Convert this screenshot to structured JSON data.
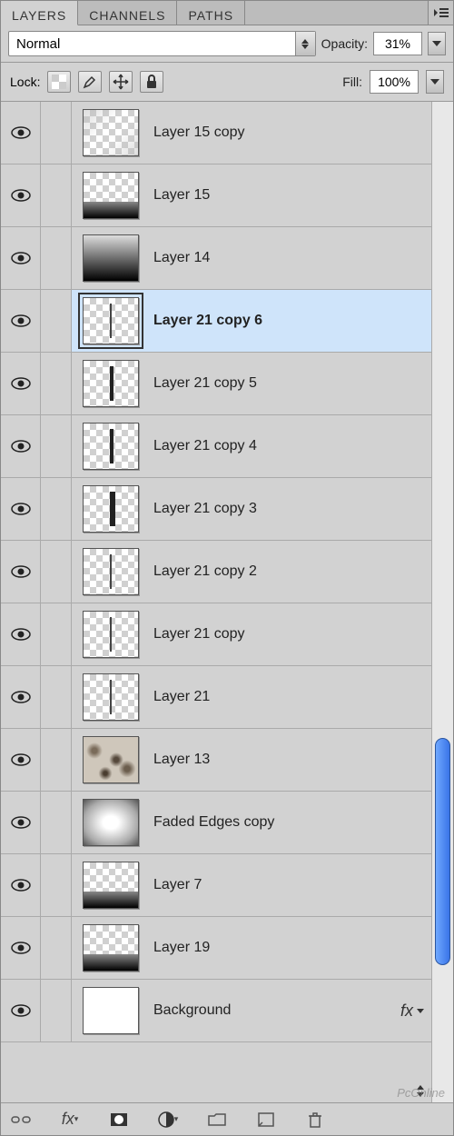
{
  "tabs": {
    "layers": "LAYERS",
    "channels": "CHANNELS",
    "paths": "PATHS"
  },
  "controls": {
    "blend_mode": "Normal",
    "opacity_label": "Opacity:",
    "opacity_value": "31%",
    "fill_label": "Fill:",
    "fill_value": "100%",
    "lock_label": "Lock:"
  },
  "layers": [
    {
      "name": "Layer 15 copy",
      "selected": false,
      "thumb": "checker-shade"
    },
    {
      "name": "Layer 15",
      "selected": false,
      "thumb": "checker-darkband"
    },
    {
      "name": "Layer 14",
      "selected": false,
      "thumb": "grad"
    },
    {
      "name": "Layer 21 copy 6",
      "selected": true,
      "thumb": "checker-vline-thin"
    },
    {
      "name": "Layer 21 copy 5",
      "selected": false,
      "thumb": "checker-vline-med"
    },
    {
      "name": "Layer 21 copy 4",
      "selected": false,
      "thumb": "checker-vline-med"
    },
    {
      "name": "Layer 21 copy 3",
      "selected": false,
      "thumb": "checker-vline-thick"
    },
    {
      "name": "Layer 21 copy 2",
      "selected": false,
      "thumb": "checker-vline-thin"
    },
    {
      "name": "Layer 21 copy",
      "selected": false,
      "thumb": "checker-vline-thin"
    },
    {
      "name": "Layer 21",
      "selected": false,
      "thumb": "checker-vline-thin"
    },
    {
      "name": "Layer 13",
      "selected": false,
      "thumb": "marble"
    },
    {
      "name": "Faded Edges copy",
      "selected": false,
      "thumb": "vignette"
    },
    {
      "name": "Layer 7",
      "selected": false,
      "thumb": "checker-darkband"
    },
    {
      "name": "Layer 19",
      "selected": false,
      "thumb": "checker-darkband"
    },
    {
      "name": "Background",
      "selected": false,
      "thumb": "white",
      "fx": true
    }
  ],
  "fx_label": "fx",
  "watermark": "PcOnline"
}
